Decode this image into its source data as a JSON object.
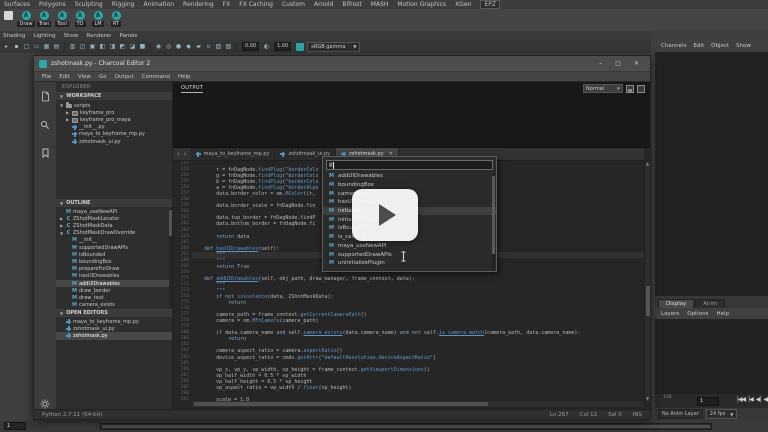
{
  "colors": {
    "accent": "#56aacb",
    "teal": "#2aa8a8",
    "selection": "#474747"
  },
  "maya": {
    "menubar": [
      "Surfaces",
      "Polygons",
      "Sculpting",
      "Rigging",
      "Animation",
      "Rendering",
      "FX",
      "FX Caching",
      "Custom",
      "Arnold",
      "Bifrost",
      "MASH",
      "Motion Graphics",
      "XGen",
      "EPZ"
    ],
    "shelf_buttons": [
      {
        "label": "Draw"
      },
      {
        "label": "Tran"
      },
      {
        "label": "Tool"
      },
      {
        "label": "TO"
      },
      {
        "label": "LM"
      },
      {
        "label": "RT"
      }
    ],
    "panel_menus": [
      "Shading",
      "Lighting",
      "Show",
      "Renderer",
      "Panels"
    ],
    "viewport_toolbar": {
      "icons": [
        "▸",
        "▪",
        "□",
        "▭",
        "▦",
        "▤",
        "▥",
        "◫",
        "▣",
        "◧",
        "◨",
        "◩",
        "◪",
        "■",
        "◉",
        "◎",
        "●",
        "◆",
        "▰",
        "▫",
        "▨",
        "▧"
      ],
      "exposure": "0.00",
      "gamma": "1.00",
      "view_transform": "sRGB gamma"
    },
    "channel_box_menus": [
      "Channels",
      "Edit",
      "Object",
      "Show"
    ],
    "layer_editor": {
      "tabs": [
        "Display",
        "Anim"
      ],
      "active_tab": "Display",
      "menus": [
        "Layers",
        "Options",
        "Help"
      ]
    },
    "timeline": {
      "range_end_label": "120",
      "current_frame": "1",
      "playback": [
        "|◀◀",
        "|◀",
        "◀|",
        "◀"
      ],
      "anim_layer": "No Anim Layer",
      "fps": "24 fps",
      "range_start": "1"
    }
  },
  "charcoal": {
    "title": "zshotmask.py - Charcoal Editor 2",
    "window_buttons": [
      "–",
      "□",
      "✕"
    ],
    "menus": [
      "File",
      "Edit",
      "View",
      "Go",
      "Output",
      "Command",
      "Help"
    ],
    "explorer_label": "EXPLORER",
    "sections": {
      "workspace": "WORKSPACE",
      "outline": "OUTLINE",
      "open_editors": "OPEN EDITORS"
    },
    "workspace_tree": [
      {
        "label": "scripts",
        "icon": "folder",
        "indent": 0,
        "arrow": "open"
      },
      {
        "label": "keyframe_pro",
        "icon": "folder-box",
        "indent": 1,
        "arrow": "closed"
      },
      {
        "label": "keyframe_pro_maya",
        "icon": "folder-box",
        "indent": 1,
        "arrow": "closed"
      },
      {
        "label": "__init__.py",
        "icon": "python",
        "indent": 1
      },
      {
        "label": "maya_to_keyframe_mp.py",
        "icon": "python",
        "indent": 1
      },
      {
        "label": "zshotmask_ui.py",
        "icon": "python",
        "indent": 1
      }
    ],
    "outline_items": [
      {
        "label": "maya_useNewAPI",
        "icon": "M",
        "indent": 0
      },
      {
        "label": "ZShotMaskLocator",
        "icon": "C",
        "indent": 0,
        "arrow": "closed"
      },
      {
        "label": "ZShotMaskData",
        "icon": "C",
        "indent": 0,
        "arrow": "closed"
      },
      {
        "label": "ZShotMaskDrawOverride",
        "icon": "C",
        "indent": 0,
        "arrow": "open"
      },
      {
        "label": "__init__",
        "icon": "M",
        "indent": 1
      },
      {
        "label": "supportedDrawAPIs",
        "icon": "M",
        "indent": 1
      },
      {
        "label": "isBounded",
        "icon": "M",
        "indent": 1
      },
      {
        "label": "boundingBox",
        "icon": "M",
        "indent": 1
      },
      {
        "label": "prepareForDraw",
        "icon": "M",
        "indent": 1
      },
      {
        "label": "hasUIDrawables",
        "icon": "M",
        "indent": 1
      },
      {
        "label": "addUIDrawables",
        "icon": "M",
        "indent": 1,
        "selected": true
      },
      {
        "label": "draw_border",
        "icon": "M",
        "indent": 1
      },
      {
        "label": "draw_text",
        "icon": "M",
        "indent": 1
      },
      {
        "label": "camera_exists",
        "icon": "M",
        "indent": 1
      }
    ],
    "open_editors": [
      {
        "label": "maya_to_keyframe_mp.py"
      },
      {
        "label": "zshotmask_ui.py"
      },
      {
        "label": "zshotmask.py",
        "selected": true
      }
    ],
    "output_panel": {
      "label": "OUTPUT",
      "mode": "Normal"
    },
    "editor_tabs": [
      {
        "label": "maya_to_keyframe_mp.py"
      },
      {
        "label": "zshotmask_ui.py"
      },
      {
        "label": "zshotmask.py",
        "active": true
      }
    ],
    "code": {
      "first_line": 252,
      "current_line": 267,
      "underlined_symbols": [
        "hasUIDrawables",
        "addUIDrawables",
        "camera_exists",
        "is_camera_match"
      ],
      "lines": [
        "",
        "        r = fnDagNode.findPlug(\"borderColo",
        "        g = fnDagNode.findPlug(\"borderColo",
        "        b = fnDagNode.findPlug(\"borderColo",
        "        a = fnDagNode.findPlug(\"borderAlph",
        "        data.border_color = om.MColor((r,",
        "",
        "        data.border_scale = fnDagNode.fin",
        "",
        "        data.top_border = fnDagNode.findP",
        "        data.bottom_border = fnDagNode.fi",
        "",
        "        return data",
        "",
        "    def hasUIDrawables(self):",
        "        \"\"\"",
        "        \"\"\"",
        "        return True",
        "",
        "    def addUIDrawables(self, obj_path, draw_manager, frame_context, data):",
        "        \"\"\"",
        "        \"\"\"",
        "        if not isinstance(data, ZShotMaskData):",
        "            return",
        "",
        "        camera_path = frame_context.getCurrentCameraPath()",
        "        camera = om.MFnCamera(camera_path)",
        "",
        "        if data.camera_name and self.camera_exists(data.camera_name) and not self.is_camera_match(camera_path, data.camera_name):",
        "            return",
        "",
        "        camera_aspect_ratio = camera.aspectRatio()",
        "        device_aspect_ratio = cmds.getAttr(\"defaultResolution.deviceAspectRatio\")",
        "",
        "        vp_x, vp_y, vp_width, vp_height = frame_context.getViewportDimensions()",
        "        vp_half_width = 0.5 * vp_width",
        "        vp_half_height = 0.5 * vp_height",
        "        vp_aspect_ratio = vp_width / float(vp_height)",
        "",
        "        scale = 1.0"
      ]
    },
    "autocomplete": {
      "query": "@",
      "selected": "initialize",
      "items": [
        "addUIDrawables",
        "boundingBox",
        "camera_exists",
        "hasUIDrawables",
        "initialize",
        "initializePlugin",
        "isBounded",
        "is_camera_match",
        "maya_useNewAPI",
        "supportedDrawAPIs",
        "uninitializePlugin"
      ]
    },
    "status": {
      "interpreter": "Python 2.7.11 (64-bit)",
      "line": "Ln 267",
      "col": "Col 12",
      "sel": "Sel 0",
      "mode": "INS"
    }
  }
}
